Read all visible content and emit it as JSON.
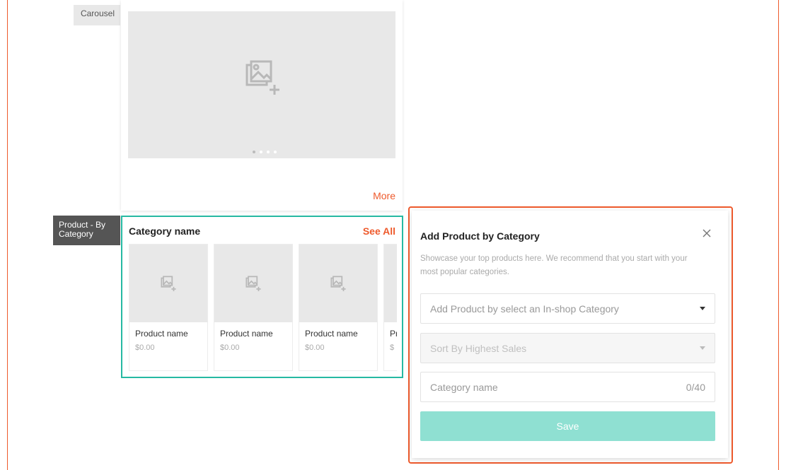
{
  "tags": {
    "carousel": "Carousel",
    "product_by_category": "Product - By Category"
  },
  "carousel": {
    "dots_total": 4,
    "active_dot": 1,
    "more_label": "More"
  },
  "category_section": {
    "title": "Category name",
    "see_all_label": "See All",
    "products": [
      {
        "name": "Product name",
        "price": "$0.00"
      },
      {
        "name": "Product name",
        "price": "$0.00"
      },
      {
        "name": "Product name",
        "price": "$0.00"
      },
      {
        "name": "Pr",
        "price": "$"
      }
    ]
  },
  "modal": {
    "title": "Add Product by Category",
    "description": "Showcase your top products here. We recommend that you start with your most popular categories.",
    "category_select_placeholder": "Add Product by select an In-shop Category",
    "sort_select_value": "Sort By Highest Sales",
    "name_placeholder": "Category name",
    "name_counter": "0/40",
    "save_label": "Save"
  },
  "colors": {
    "accent": "#ee5a2c",
    "teal": "#26b9a2",
    "save_disabled": "#8fe0d2",
    "placeholder_bg": "#e8e8e8"
  },
  "icons": {
    "image_placeholder": "image-plus-icon",
    "close": "close-icon",
    "dropdown": "caret-down-icon"
  }
}
